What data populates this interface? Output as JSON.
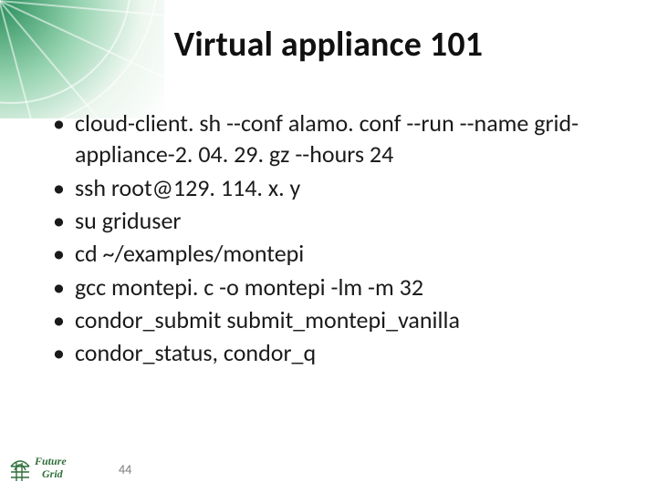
{
  "title": "Virtual appliance 101",
  "bullets": [
    "cloud-client. sh --conf alamo. conf --run --name grid-appliance-2. 04. 29. gz --hours 24",
    "ssh root@129. 114. x. y",
    "su griduser",
    "cd ~/examples/montepi",
    "gcc montepi. c -o montepi -lm -m 32",
    "condor_submit submit_montepi_vanilla",
    "condor_status, condor_q"
  ],
  "page_number": "44",
  "logo_text": "Future Grid"
}
